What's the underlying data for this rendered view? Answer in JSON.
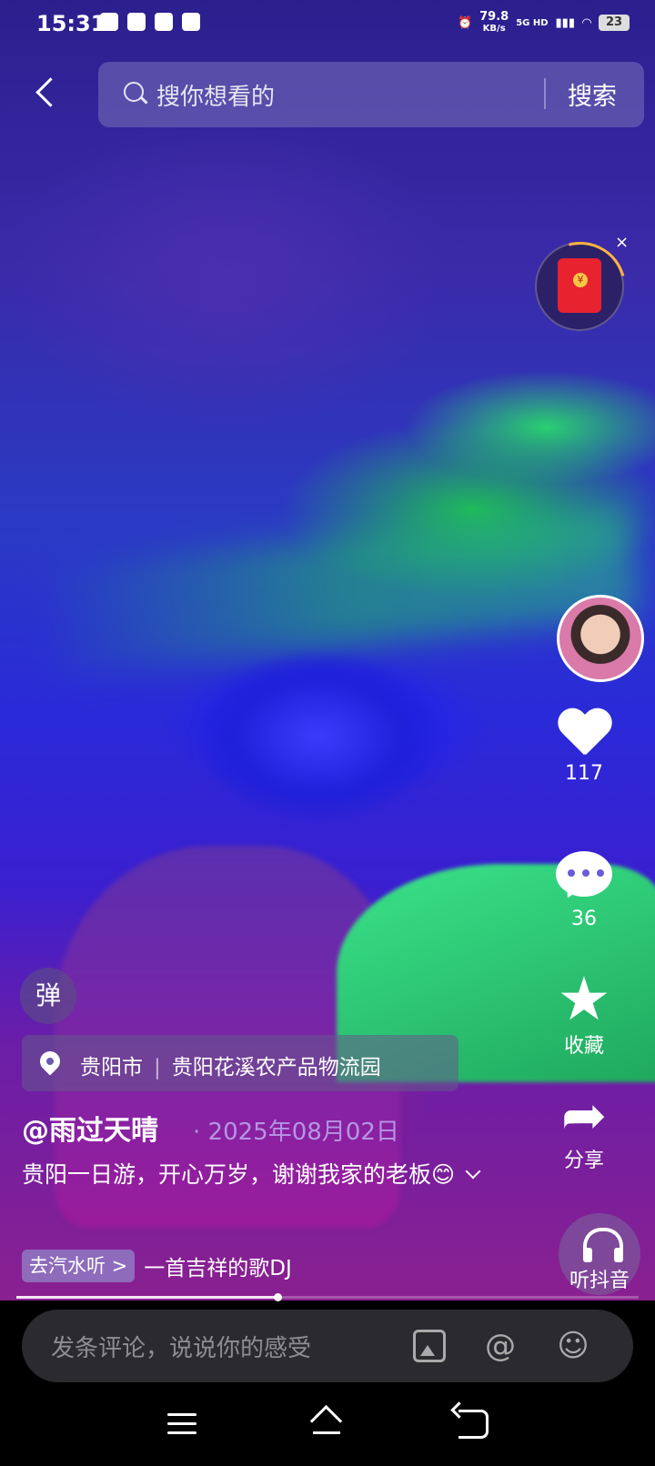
{
  "status_bar": {
    "time": "15:31",
    "net_speed_value": "79.8",
    "net_speed_unit": "KB/s",
    "network": "5G HD",
    "battery": "23"
  },
  "search": {
    "placeholder": "搜你想看的",
    "button": "搜索"
  },
  "red_packet": {
    "close": "×"
  },
  "actions": {
    "like_count": "117",
    "comment_count": "36",
    "favorite_label": "收藏",
    "share_label": "分享",
    "listen_label": "听抖音"
  },
  "danmu": {
    "label": "弹"
  },
  "location": {
    "city": "贵阳市",
    "place": "贵阳花溪农产品物流园"
  },
  "post": {
    "author": "@雨过天晴",
    "date": "· 2025年08月02日",
    "description": "贵阳一日游，开心万岁，谢谢我家的老板😊"
  },
  "music": {
    "tag": "去汽水听 >",
    "song": "一首吉祥的歌DJ"
  },
  "progress": {
    "value": 0.42
  },
  "comment_bar": {
    "placeholder": "发条评论，说说你的感受"
  }
}
